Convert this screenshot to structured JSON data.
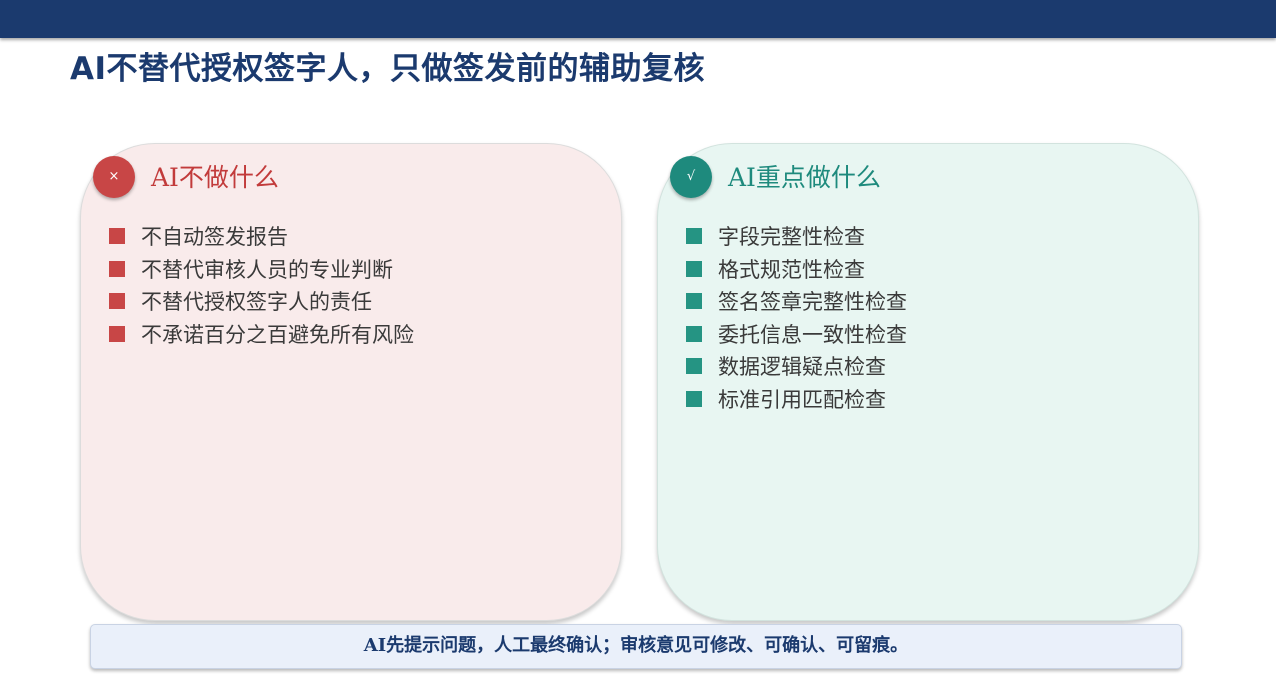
{
  "header": {
    "title": "AI不替代授权签字人，只做签发前的辅助复核",
    "bar_color": "#1b3a6e"
  },
  "left_card": {
    "badge_symbol": "×",
    "badge_icon": "x-mark-icon",
    "title": "AI不做什么",
    "accent_color": "#c84646",
    "items": [
      "不自动签发报告",
      "不替代审核人员的专业判断",
      "不替代授权签字人的责任",
      "不承诺百分之百避免所有风险"
    ]
  },
  "right_card": {
    "badge_symbol": "√",
    "badge_icon": "check-mark-icon",
    "title": "AI重点做什么",
    "accent_color": "#1e8a7d",
    "items": [
      "字段完整性检查",
      "格式规范性检查",
      "签名签章完整性检查",
      "委托信息一致性检查",
      "数据逻辑疑点检查",
      "标准引用匹配检查"
    ]
  },
  "footer": {
    "text": "AI先提示问题，人工最终确认；审核意见可修改、可确认、可留痕。"
  }
}
